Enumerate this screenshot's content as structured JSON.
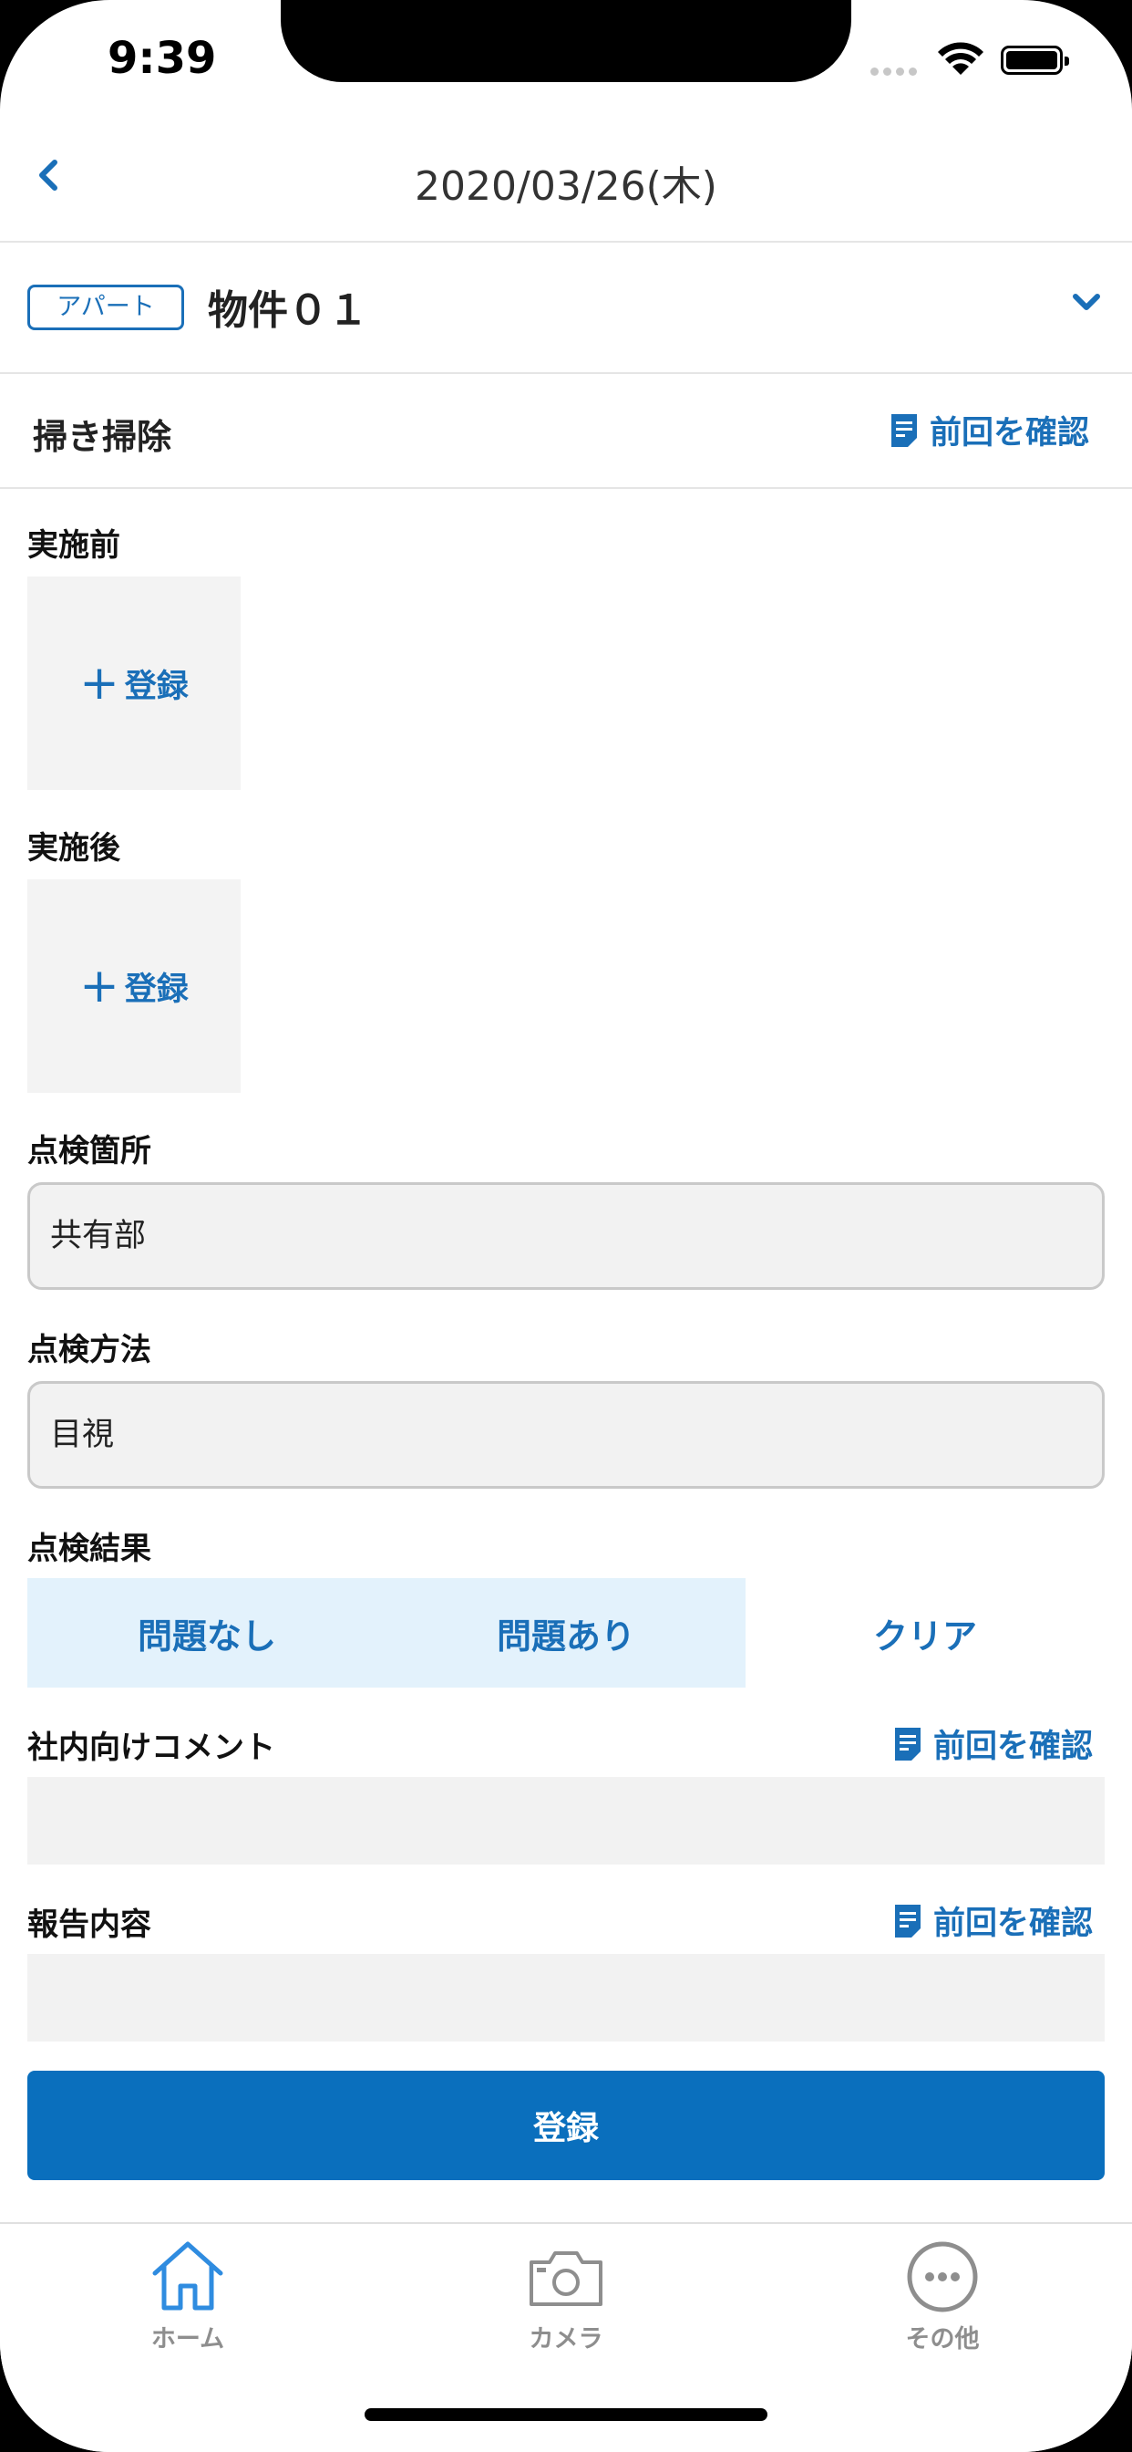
{
  "status_bar": {
    "time": "9:39"
  },
  "nav": {
    "title": "2020/03/26(木)"
  },
  "property": {
    "type_badge": "アパート",
    "name": "物件０１"
  },
  "task": {
    "title": "掃き掃除",
    "prev_check_label": "前回を確認"
  },
  "before": {
    "label": "実施前",
    "register_label": "登録"
  },
  "after": {
    "label": "実施後",
    "register_label": "登録"
  },
  "inspection_location": {
    "label": "点検箇所",
    "value": "共有部"
  },
  "inspection_method": {
    "label": "点検方法",
    "value": "目視"
  },
  "inspection_result": {
    "label": "点検結果",
    "options": [
      "問題なし",
      "問題あり",
      "クリア"
    ]
  },
  "internal_comment": {
    "label": "社内向けコメント",
    "prev_check_label": "前回を確認",
    "value": ""
  },
  "report": {
    "label": "報告内容",
    "prev_check_label": "前回を確認",
    "value": ""
  },
  "submit_label": "登録",
  "tabs": [
    {
      "label": "ホーム",
      "icon": "home-icon",
      "active": true
    },
    {
      "label": "カメラ",
      "icon": "camera-icon",
      "active": false
    },
    {
      "label": "その他",
      "icon": "more-icon",
      "active": false
    }
  ],
  "colors": {
    "accent": "#0a6fbd",
    "link": "#1a6fb8",
    "segment_bg": "#e3f2fc",
    "field_bg": "#f2f2f2",
    "tab_active": "#2f8ce0",
    "tab_inactive": "#8e8e8e"
  }
}
